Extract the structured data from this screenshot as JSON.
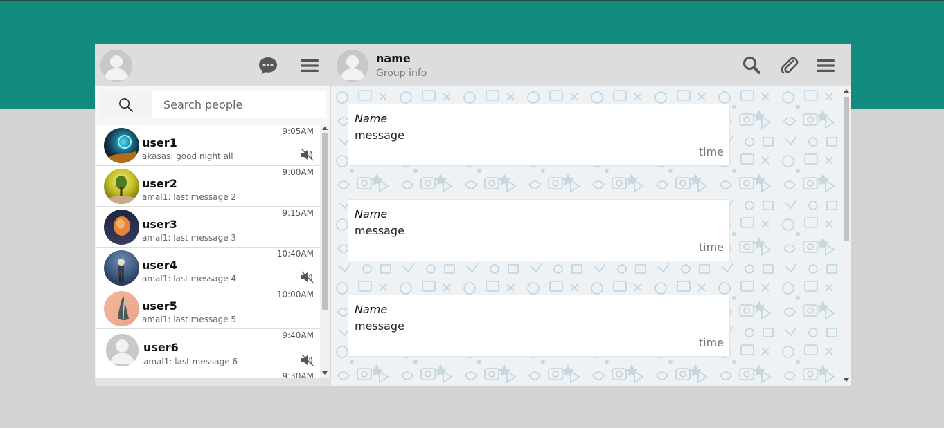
{
  "colors": {
    "top_band": "#138c7f",
    "background": "#d4d3d3",
    "header": "#dddddd",
    "icon": "#555555"
  },
  "left_header": {
    "avatar_icon": "default-user-icon",
    "chat_icon": "chat-bubble-icon",
    "menu_icon": "hamburger-menu-icon"
  },
  "search": {
    "icon": "search-icon",
    "placeholder": "Search people"
  },
  "chats": [
    {
      "name": "user1",
      "last": "akasas: good night all",
      "time": "9:05AM",
      "muted": true
    },
    {
      "name": "user2",
      "last": "amal1: last message 2",
      "time": "9:00AM",
      "muted": false
    },
    {
      "name": "user3",
      "last": "amal1: last message 3",
      "time": "9:15AM",
      "muted": false
    },
    {
      "name": "user4",
      "last": "amal1: last message 4",
      "time": "10:40AM",
      "muted": true
    },
    {
      "name": "user5",
      "last": "amal1: last message 5",
      "time": "10:00AM",
      "muted": false
    },
    {
      "name": "user6",
      "last": "amal1: last message 6",
      "time": "9:40AM",
      "muted": true
    },
    {
      "name": "",
      "last": "",
      "time": "9:30AM",
      "muted": false
    }
  ],
  "conversation": {
    "name": "name",
    "subtitle": "Group info",
    "icons": [
      "search-icon",
      "paperclip-icon",
      "hamburger-menu-icon"
    ]
  },
  "messages": [
    {
      "name": "Name",
      "text": "message",
      "time": "time"
    },
    {
      "name": "Name",
      "text": "message",
      "time": "time"
    },
    {
      "name": "Name",
      "text": "message",
      "time": "time"
    }
  ]
}
